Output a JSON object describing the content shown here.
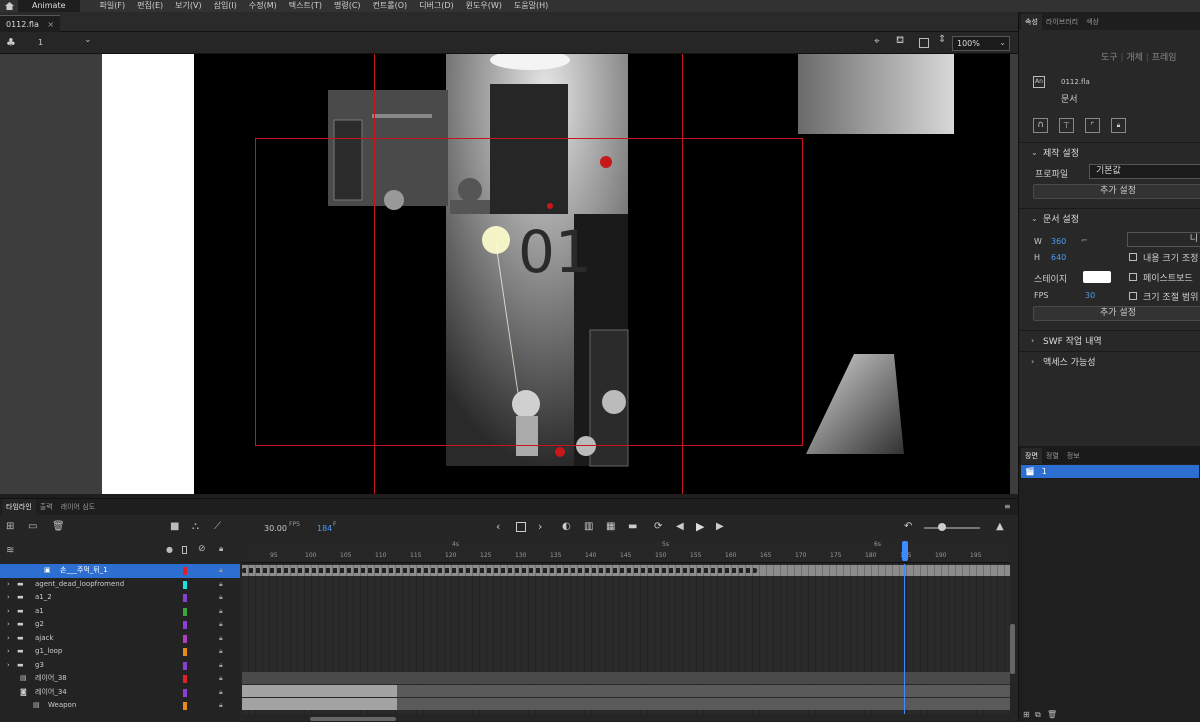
{
  "app": {
    "name": "Animate"
  },
  "menu": [
    "파일(F)",
    "편집(E)",
    "보기(V)",
    "삽입(I)",
    "수정(M)",
    "텍스트(T)",
    "명령(C)",
    "컨트롤(O)",
    "디버그(D)",
    "윈도우(W)",
    "도움말(H)"
  ],
  "doc_tab": {
    "name": "0112.fla",
    "close": "×"
  },
  "scene_bar": {
    "scene_number": "1",
    "zoom": "100%"
  },
  "stage_overlay": {
    "big_text": "01"
  },
  "properties": {
    "tabs": [
      "속성",
      "라이브러리",
      "색상"
    ],
    "sub_tabs": [
      "도구",
      "개체",
      "프레임"
    ],
    "doc_file": "0112.fla",
    "doc_type": "문서",
    "doc_badge": "An",
    "production_settings": {
      "title": "제작 설정",
      "profile_label": "프로파일",
      "profile_value": "기본값",
      "more_button": "추가 설정"
    },
    "document_settings": {
      "title": "문서 설정",
      "w_label": "W",
      "w_value": "360",
      "h_label": "H",
      "h_value": "640",
      "stage_label": "스테이지",
      "fps_label": "FPS",
      "fps_value": "30",
      "stage_color": "#ffffff",
      "scale_content": "내용 크기 조정",
      "scale_pasteboard": "페이스트보드",
      "scale_range": "크기 조절 범위",
      "unit_button": "니",
      "more_button": "추가 설정"
    },
    "swf_history": "SWF 작업 내역",
    "accessibility": "액세스 가능성"
  },
  "scene_panel": {
    "tabs": [
      "장면",
      "정렬",
      "정보"
    ],
    "scene_name": "1"
  },
  "timeline": {
    "tabs": [
      "타임라인",
      "출력",
      "레이어 심도"
    ],
    "fps_display": "30.00",
    "fps_unit": "FPS",
    "current_frame": "184",
    "frame_unit": "F",
    "ruler_numbers": [
      "95",
      "100",
      "105",
      "110",
      "115",
      "120",
      "125",
      "130",
      "135",
      "140",
      "145",
      "150",
      "155",
      "160",
      "165",
      "170",
      "175",
      "180",
      "185",
      "190",
      "195"
    ],
    "seconds_markers": [
      "4s",
      "5s",
      "6s"
    ],
    "layers": [
      {
        "name": "손___주먹_뒤_1",
        "color": "#e0202a",
        "type": "symbol",
        "selected": true
      },
      {
        "name": "agent_dead_loopfromend",
        "color": "#19e3e3",
        "type": "folder"
      },
      {
        "name": "a1_2",
        "color": "#8a3fd6",
        "type": "folder"
      },
      {
        "name": "a1",
        "color": "#3aa83a",
        "type": "folder"
      },
      {
        "name": "g2",
        "color": "#8a3fd6",
        "type": "folder"
      },
      {
        "name": "ajack",
        "color": "#b03fc6",
        "type": "folder"
      },
      {
        "name": "g1_loop",
        "color": "#e88a1a",
        "type": "folder"
      },
      {
        "name": "g3",
        "color": "#8a3fd6",
        "type": "folder"
      },
      {
        "name": "레이어_38",
        "color": "#e0202a",
        "type": "layer"
      },
      {
        "name": "레이어_34",
        "color": "#8a3fd6",
        "type": "mask"
      },
      {
        "name": "Weapon",
        "color": "#e88a1a",
        "type": "layer"
      }
    ]
  },
  "colors": {
    "accent": "#2d6fd0",
    "panel": "#282828",
    "guide": "#c8141e"
  }
}
